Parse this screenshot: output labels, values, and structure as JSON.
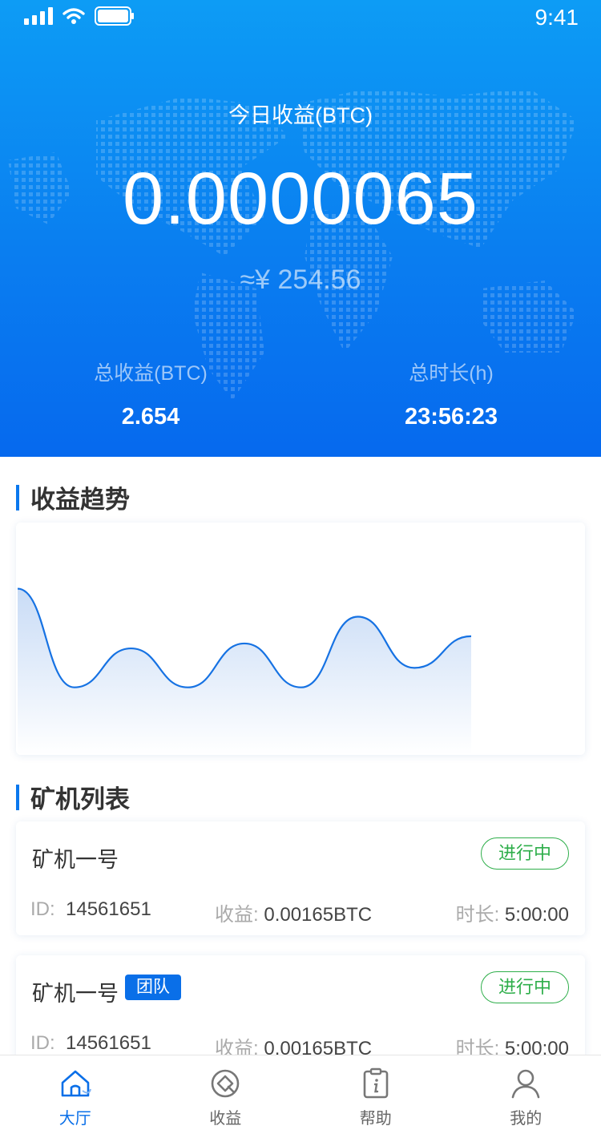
{
  "status_bar": {
    "time": "9:41"
  },
  "hero": {
    "today_label": "今日收益(BTC)",
    "today_value": "0.0000065",
    "cny_value": "≈¥ 254.56",
    "total_income_label": "总收益(BTC)",
    "total_income_value": "2.654",
    "total_duration_label": "总时长(h)",
    "total_duration_value": "23:56:23"
  },
  "trend": {
    "title": "收益趋势",
    "chart_data": {
      "type": "area",
      "xlabel": "",
      "ylabel": "",
      "grid": false,
      "x": [
        0,
        1,
        2,
        3,
        4,
        5,
        6,
        7,
        8,
        9,
        10
      ],
      "values": [
        0.97,
        0.16,
        0.48,
        0.16,
        0.52,
        0.16,
        0.74,
        0.32,
        0.58
      ],
      "colors": {
        "line": "#1672e3",
        "fill_top": "#c9dcf6",
        "fill_bottom": "#ffffff"
      }
    }
  },
  "miners": {
    "title": "矿机列表",
    "id_label": "ID:",
    "income_label": "收益:",
    "duration_label": "时长:",
    "items": [
      {
        "name": "矿机一号",
        "badge": "",
        "status": "进行中",
        "id": "14561651",
        "income": "0.00165BTC",
        "duration": "5:00:00"
      },
      {
        "name": "矿机一号",
        "badge": "团队",
        "status": "进行中",
        "id": "14561651",
        "income": "0.00165BTC",
        "duration": "5:00:00"
      }
    ]
  },
  "tabs": [
    {
      "label": "大厅",
      "icon": "home-icon",
      "active": true
    },
    {
      "label": "收益",
      "icon": "income-icon",
      "active": false
    },
    {
      "label": "帮助",
      "icon": "help-icon",
      "active": false
    },
    {
      "label": "我的",
      "icon": "user-icon",
      "active": false
    }
  ],
  "colors": {
    "primary": "#0a6fe8",
    "running": "#2eae4a"
  }
}
